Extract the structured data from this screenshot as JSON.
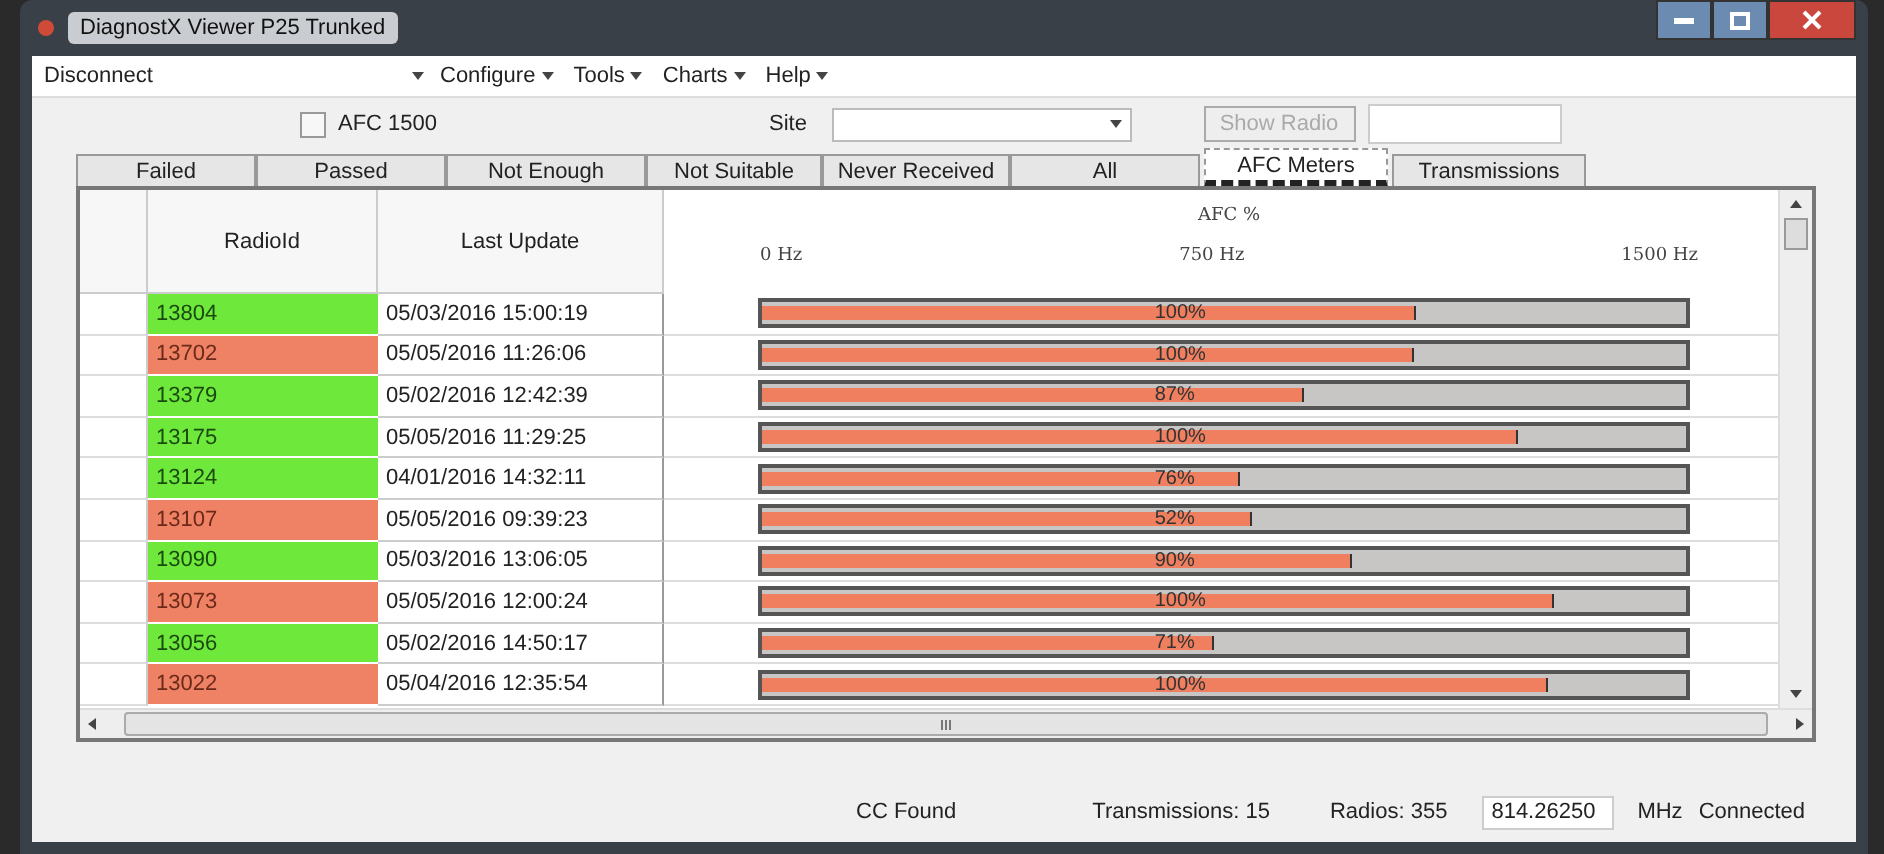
{
  "window": {
    "title": "DiagnostX Viewer P25 Trunked"
  },
  "toolbar": {
    "connection": "Disconnect",
    "menus": [
      "Configure",
      "Tools",
      "Charts",
      "Help"
    ]
  },
  "filters": {
    "afc_checkbox": {
      "label": "AFC 1500",
      "checked": false
    },
    "site_label": "Site",
    "show_radio_button": {
      "label": "Show Radio",
      "disabled": true
    }
  },
  "tabs": [
    {
      "label": "Failed",
      "selected": false
    },
    {
      "label": "Passed",
      "selected": false
    },
    {
      "label": "Not Enough",
      "selected": false
    },
    {
      "label": "Not Suitable",
      "selected": false
    },
    {
      "label": "Never Received",
      "selected": false
    },
    {
      "label": "All",
      "selected": false
    },
    {
      "label": "AFC Meters",
      "selected": true
    },
    {
      "label": "Transmissions",
      "selected": false
    }
  ],
  "table": {
    "columns": [
      "RadioId",
      "Last Update"
    ],
    "meter_title": "AFC %",
    "meter_scale": [
      "0 Hz",
      "750 Hz",
      "1500 Hz"
    ],
    "rows": [
      {
        "radio_id": "13804",
        "color": "#6ee83a",
        "last_update": "05/03/2016 15:00:19",
        "reading": "100%",
        "level": 0.706
      },
      {
        "radio_id": "13702",
        "color": "#ef8164",
        "last_update": "05/05/2016 11:26:06",
        "reading": "100%",
        "level": 0.704
      },
      {
        "radio_id": "13379",
        "color": "#6ee83a",
        "last_update": "05/02/2016 12:42:39",
        "reading": "87%",
        "level": 0.584
      },
      {
        "radio_id": "13175",
        "color": "#6ee83a",
        "last_update": "05/05/2016 11:29:25",
        "reading": "100%",
        "level": 0.816
      },
      {
        "radio_id": "13124",
        "color": "#6ee83a",
        "last_update": "04/01/2016 14:32:11",
        "reading": "76%",
        "level": 0.516
      },
      {
        "radio_id": "13107",
        "color": "#ef8164",
        "last_update": "05/05/2016 09:39:23",
        "reading": "52%",
        "level": 0.529
      },
      {
        "radio_id": "13090",
        "color": "#6ee83a",
        "last_update": "05/03/2016 13:06:05",
        "reading": "90%",
        "level": 0.636
      },
      {
        "radio_id": "13073",
        "color": "#ef8164",
        "last_update": "05/05/2016 12:00:24",
        "reading": "100%",
        "level": 0.854
      },
      {
        "radio_id": "13056",
        "color": "#6ee83a",
        "last_update": "05/02/2016 14:50:17",
        "reading": "71%",
        "level": 0.486
      },
      {
        "radio_id": "13022",
        "color": "#ef8164",
        "last_update": "05/04/2016 12:35:54",
        "reading": "100%",
        "level": 0.848
      }
    ]
  },
  "status_bar": {
    "cc_status": "CC Found",
    "transmissions": "Transmissions: 15",
    "radios": "Radios: 355",
    "frequency": "814.26250",
    "unit": "MHz",
    "connection": "Connected"
  }
}
